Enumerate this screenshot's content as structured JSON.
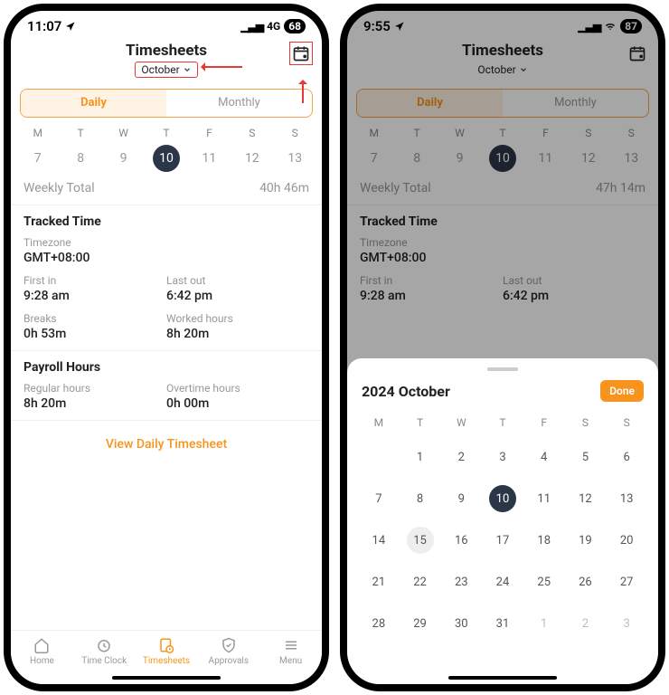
{
  "left": {
    "status": {
      "time": "11:07",
      "net": "4G",
      "battery": "68"
    },
    "header": {
      "title": "Timesheets",
      "month": "October"
    },
    "segments": {
      "daily": "Daily",
      "monthly": "Monthly"
    },
    "week": {
      "dow": [
        "M",
        "T",
        "W",
        "T",
        "F",
        "S",
        "S"
      ],
      "days": [
        "7",
        "8",
        "9",
        "10",
        "11",
        "12",
        "13"
      ],
      "selected_index": 3
    },
    "weekly_total": {
      "label": "Weekly Total",
      "value": "40h 46m"
    },
    "tracked": {
      "title": "Tracked Time",
      "timezone_label": "Timezone",
      "timezone": "GMT+08:00",
      "first_in_label": "First in",
      "first_in": "9:28 am",
      "last_out_label": "Last out",
      "last_out": "6:42 pm",
      "breaks_label": "Breaks",
      "breaks": "0h 53m",
      "worked_label": "Worked hours",
      "worked": "8h 20m"
    },
    "payroll": {
      "title": "Payroll Hours",
      "regular_label": "Regular hours",
      "regular": "8h 20m",
      "overtime_label": "Overtime hours",
      "overtime": "0h 00m"
    },
    "view_link": "View Daily Timesheet",
    "tabs": {
      "home": "Home",
      "timeclock": "Time Clock",
      "timesheets": "Timesheets",
      "approvals": "Approvals",
      "menu": "Menu"
    }
  },
  "right": {
    "status": {
      "time": "9:55",
      "net": "",
      "battery": "87"
    },
    "header": {
      "title": "Timesheets",
      "month": "October"
    },
    "segments": {
      "daily": "Daily",
      "monthly": "Monthly"
    },
    "week": {
      "dow": [
        "M",
        "T",
        "W",
        "T",
        "F",
        "S",
        "S"
      ],
      "days": [
        "7",
        "8",
        "9",
        "10",
        "11",
        "12",
        "13"
      ],
      "selected_index": 3
    },
    "weekly_total": {
      "label": "Weekly Total",
      "value": "47h 14m"
    },
    "tracked": {
      "title": "Tracked Time",
      "timezone_label": "Timezone",
      "timezone": "GMT+08:00",
      "first_in_label": "First in",
      "first_in": "9:28 am",
      "last_out_label": "Last out",
      "last_out": "6:42 pm"
    },
    "picker": {
      "title": "2024 October",
      "done": "Done",
      "dow": [
        "M",
        "T",
        "W",
        "T",
        "F",
        "S",
        "S"
      ],
      "weeks": [
        [
          "",
          "1",
          "2",
          "3",
          "4",
          "5",
          "6"
        ],
        [
          "7",
          "8",
          "9",
          "10",
          "11",
          "12",
          "13"
        ],
        [
          "14",
          "15",
          "16",
          "17",
          "18",
          "19",
          "20"
        ],
        [
          "21",
          "22",
          "23",
          "24",
          "25",
          "26",
          "27"
        ],
        [
          "28",
          "29",
          "30",
          "31",
          "1*",
          "2*",
          "3*"
        ]
      ],
      "selected": "10",
      "today": "15"
    }
  }
}
